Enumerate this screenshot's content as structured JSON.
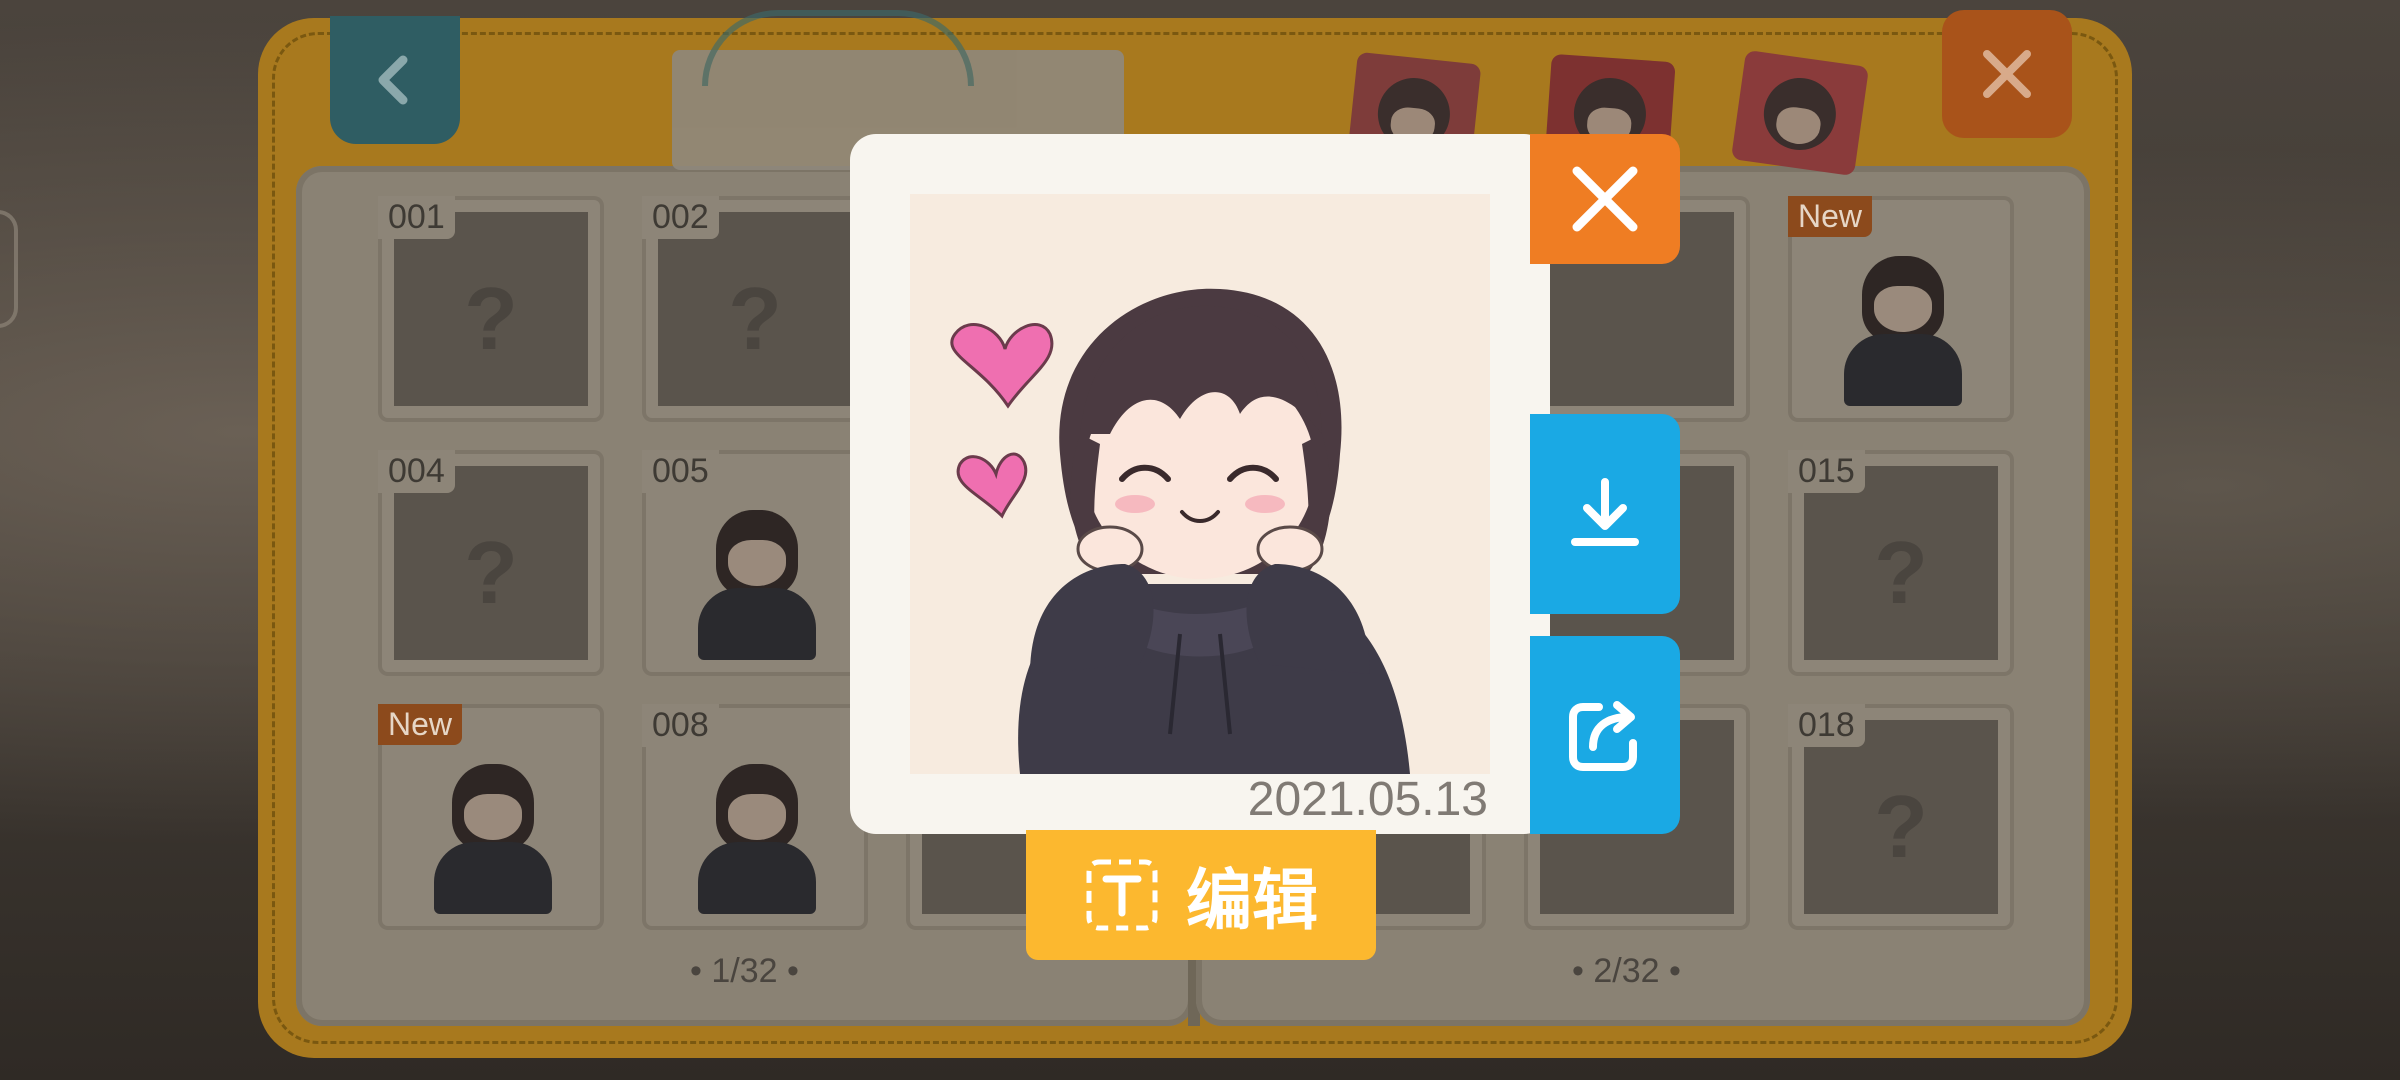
{
  "book": {
    "back_icon": "chevron-left-icon",
    "close_icon": "close-icon",
    "left_page": {
      "pager": "• 1/32 •",
      "cards": [
        {
          "num": "001",
          "state": "locked",
          "mark": "?"
        },
        {
          "num": "002",
          "state": "locked",
          "mark": "?"
        },
        {
          "num": "004",
          "state": "locked",
          "mark": "?"
        },
        {
          "num": "005",
          "state": "unlocked"
        },
        {
          "badge": "New",
          "state": "unlocked"
        },
        {
          "num": "008",
          "state": "unlocked"
        }
      ]
    },
    "right_page": {
      "pager": "• 2/32 •",
      "cards": [
        {
          "badge": "New",
          "state": "unlocked"
        },
        {
          "num": "015",
          "state": "locked",
          "mark": "?"
        },
        {
          "num": "018",
          "state": "locked",
          "mark": "?"
        }
      ]
    }
  },
  "modal": {
    "date": "2021.05.13",
    "edit_label": "编辑",
    "close_icon": "close-icon",
    "download_icon": "download-icon",
    "share_icon": "share-icon",
    "colors": {
      "close": "#ef7d23",
      "action": "#1aa9e4",
      "edit": "#fcb82f"
    }
  }
}
